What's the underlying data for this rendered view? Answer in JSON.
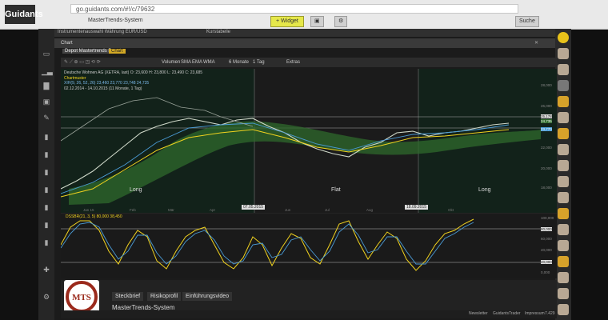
{
  "browser": {
    "brand": "Guidants",
    "address": "go.guidants.com/#!/c/79632",
    "workspace": "MasterTrends-System",
    "btn_green": "+ Widget",
    "btn_search": "Suche"
  },
  "tabs": {
    "left": "Instrumentenauswahl Währung EUR/USD",
    "right": "Kurstabelle"
  },
  "chart_window": {
    "title": "Chart",
    "subtab_active": "Depot Mastertrends Depot",
    "subtab_other": "Chart"
  },
  "toolbar": {
    "items": [
      "Volumen",
      "SMA",
      "EMA",
      "WMA",
      "6 Monate",
      "1 Tag",
      "Extras"
    ]
  },
  "legend": {
    "instrument": "Deutsche Wohnen AG (XETRA, last) O: 23,600 H: 23,800 L: 23,490 C: 23,685",
    "pattern": "Chartmuster",
    "ichimoku": "XIH(9, 26, 52, 26) 23,460 23,770 23,748 24,735",
    "date_range": "02.12.2014 - 14.10.2015 (11 Monate, 1 Tag)"
  },
  "chart_labels": {
    "long1": "Long",
    "flat": "Flat",
    "long2": "Long",
    "date1": "07.05.2015",
    "date2": "18.09.2015",
    "months": [
      "Jan 15",
      "Feb",
      "Mär",
      "Apr",
      "Jun",
      "Jul",
      "Aug",
      "Okt"
    ],
    "y_ticks": [
      "28,000",
      "26,000",
      "22,000",
      "20,000",
      "18,000"
    ],
    "price_boxes": [
      "25,178",
      "24,735",
      "23,770"
    ]
  },
  "oscillator": {
    "label": "DSSBR(21, 3, 5) 80,000 38,450",
    "levels": [
      "100,000",
      "80,000",
      "20,000",
      "0,000"
    ],
    "y_ticks": [
      "60,000",
      "40,000"
    ]
  },
  "bottom": {
    "logo_text": "MTS",
    "tabs": [
      "Steckbrief",
      "Risikoprofil",
      "Einführungsvideo"
    ],
    "title": "MasterTrends-System"
  },
  "footer": {
    "links": [
      "Newsletter",
      "GuidantsTrader",
      "Impressum"
    ],
    "counter": "7.429"
  },
  "colors": {
    "accent_yellow": "#f0d21e",
    "ichimoku_green": "#2f6a2c",
    "blue_line": "#4a9bd6"
  }
}
